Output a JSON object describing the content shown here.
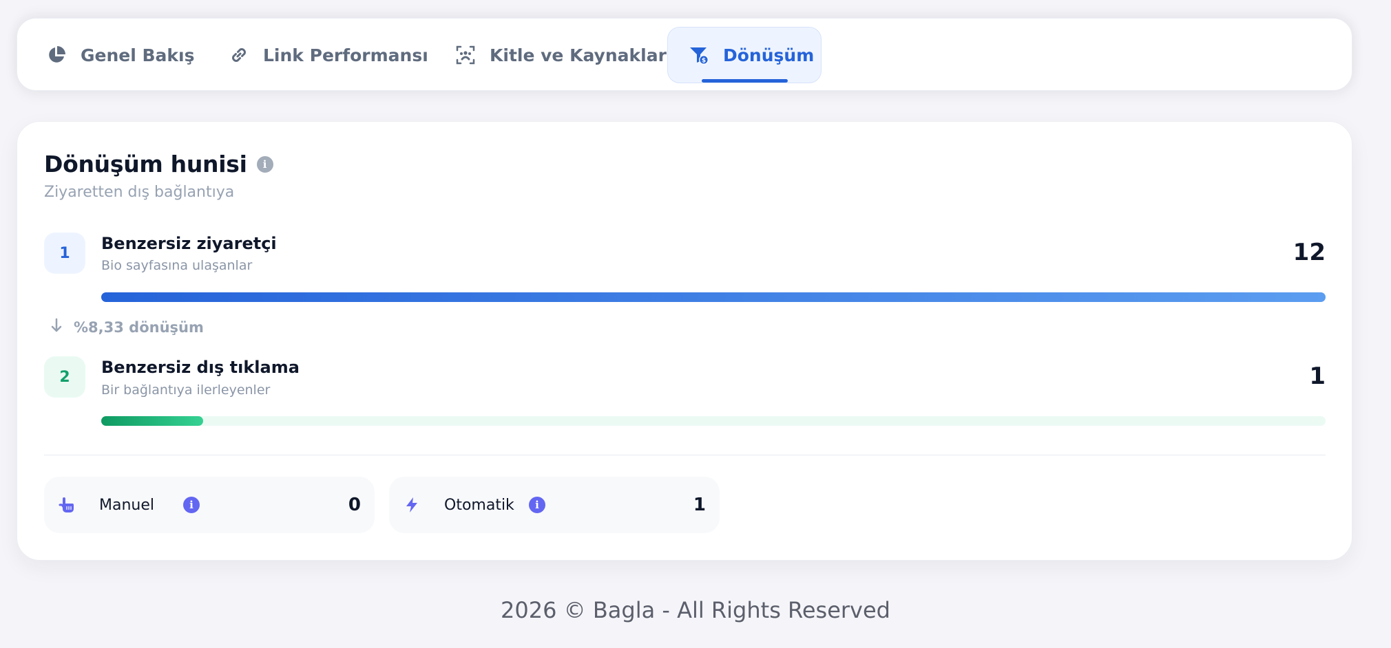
{
  "tabs": [
    {
      "label": "Genel Bakış",
      "icon": "pie-chart-icon",
      "active": false
    },
    {
      "label": "Link Performansı",
      "icon": "link-icon",
      "active": false
    },
    {
      "label": "Kitle ve Kaynaklar",
      "icon": "audience-icon",
      "active": false
    },
    {
      "label": "Dönüşüm",
      "icon": "funnel-icon",
      "active": true
    }
  ],
  "funnel": {
    "title": "Dönüşüm hunisi",
    "subtitle": "Ziyaretten dış bağlantıya",
    "steps": [
      {
        "number": "1",
        "title": "Benzersiz ziyaretçi",
        "description": "Bio sayfasına ulaşanlar",
        "value": "12",
        "fill_fraction": 1.0
      },
      {
        "number": "2",
        "title": "Benzersiz dış tıklama",
        "description": "Bir bağlantıya ilerleyenler",
        "value": "1",
        "fill_fraction": 0.0833
      }
    ],
    "conversion_rate": "%8,33 dönüşüm"
  },
  "modes": [
    {
      "label": "Manuel",
      "value": "0",
      "icon": "hand-pointer-icon"
    },
    {
      "label": "Otomatik",
      "value": "1",
      "icon": "lightning-icon"
    }
  ],
  "footer": {
    "text": "2026 © Bagla - All Rights Reserved"
  },
  "colors": {
    "accent_blue": "#2563d9",
    "accent_green": "#12a06b",
    "accent_indigo": "#6366f1",
    "muted_text": "#97a2b2"
  }
}
